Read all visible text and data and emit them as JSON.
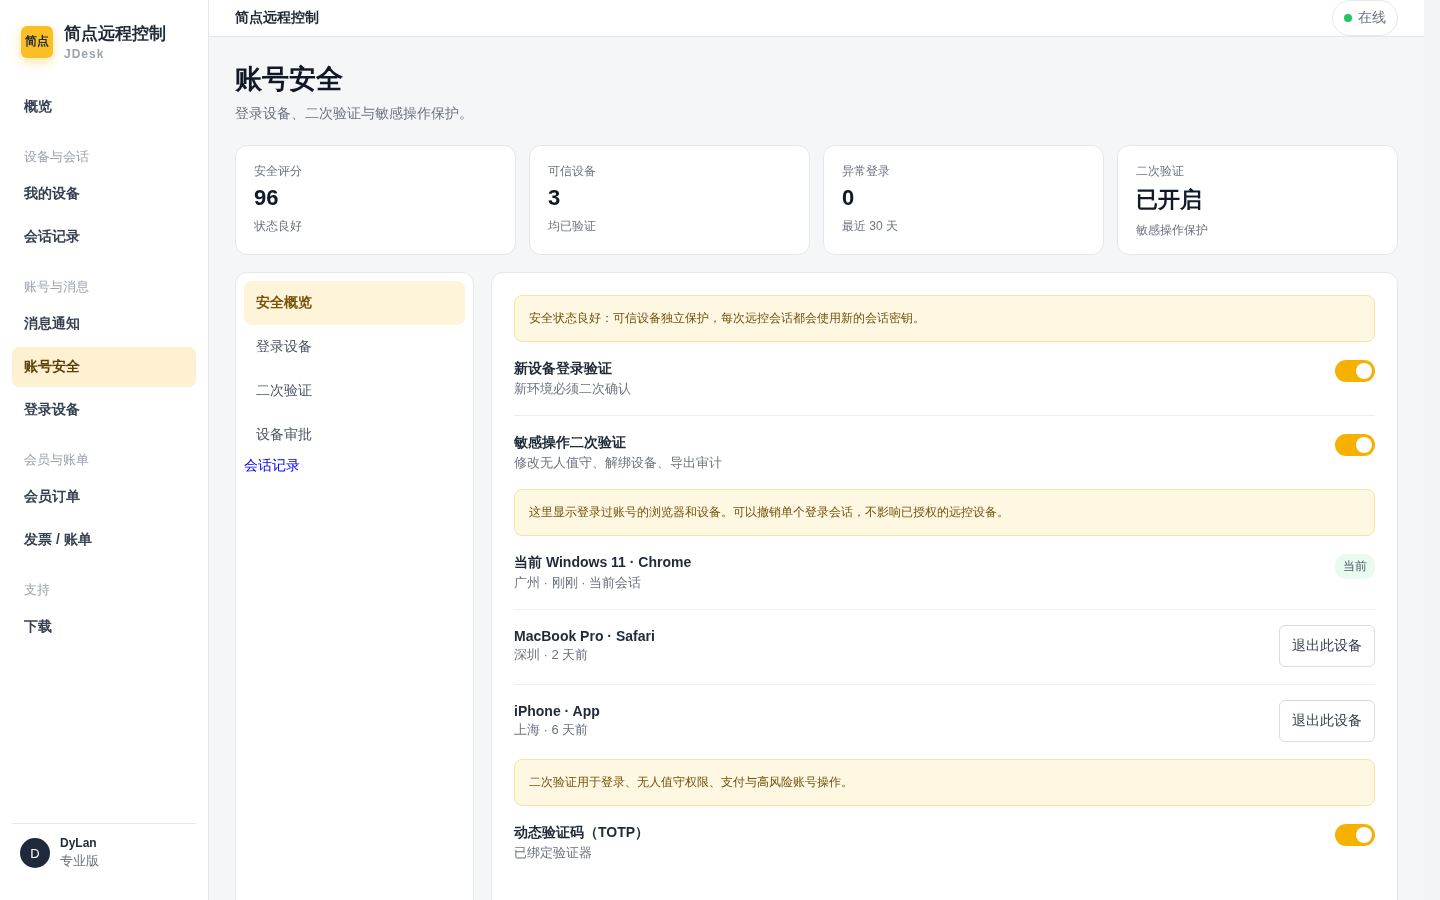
{
  "brand": {
    "logo": "简点",
    "name": "简点远程控制",
    "sub": "JDesk"
  },
  "sidebar": {
    "groups": [
      {
        "items": [
          {
            "label": "概览",
            "selected": false
          }
        ]
      },
      {
        "label": "设备与会话",
        "items": [
          {
            "label": "我的设备",
            "selected": false
          },
          {
            "label": "会话记录",
            "selected": false
          }
        ]
      },
      {
        "label": "账号与消息",
        "items": [
          {
            "label": "消息通知",
            "selected": false
          },
          {
            "label": "账号安全",
            "selected": true
          },
          {
            "label": "登录设备",
            "selected": false
          }
        ]
      },
      {
        "label": "会员与账单",
        "items": [
          {
            "label": "会员订单",
            "selected": false
          },
          {
            "label": "发票 / 账单",
            "selected": false
          }
        ]
      },
      {
        "label": "支持",
        "items": [
          {
            "label": "下载",
            "selected": false
          }
        ]
      }
    ]
  },
  "user": {
    "initial": "D",
    "name": "DyLan",
    "plan": "专业版"
  },
  "topbar": {
    "title": "简点远程控制",
    "status": {
      "label": "在线",
      "color": "#22c55e"
    }
  },
  "page": {
    "title": "账号安全",
    "subtitle": "登录设备、二次验证与敏感操作保护。"
  },
  "stats": [
    {
      "label": "安全评分",
      "value": "96",
      "note": "状态良好"
    },
    {
      "label": "可信设备",
      "value": "3",
      "note": "均已验证"
    },
    {
      "label": "异常登录",
      "value": "0",
      "note": "最近 30 天"
    },
    {
      "label": "二次验证",
      "value": "已开启",
      "note": "敏感操作保护"
    }
  ],
  "subnav": [
    {
      "kind": "tab",
      "label": "安全概览",
      "selected": true
    },
    {
      "kind": "tab",
      "label": "登录设备",
      "selected": false
    },
    {
      "kind": "tab",
      "label": "二次验证",
      "selected": false
    },
    {
      "kind": "tab",
      "label": "设备审批",
      "selected": false
    },
    {
      "kind": "link",
      "label": "会话记录",
      "selected": false
    }
  ],
  "rows": [
    {
      "kind": "notice",
      "text": "安全状态良好：可信设备独立保护，每次远控会话都会使用新的会话密钥。"
    },
    {
      "kind": "toggle",
      "title": "新设备登录验证",
      "sub": "新环境必须二次确认",
      "on": true
    },
    {
      "kind": "toggle",
      "title": "敏感操作二次验证",
      "sub": "修改无人值守、解绑设备、导出审计",
      "on": true
    },
    {
      "kind": "notice",
      "text": "这里显示登录过账号的浏览器和设备。可以撤销单个登录会话，不影响已授权的远控设备。"
    },
    {
      "kind": "device",
      "title": "当前 Windows 11 · Chrome",
      "sub": "广州 · 刚刚 · 当前会话",
      "badge": "当前"
    },
    {
      "kind": "device",
      "title": "MacBook Pro · Safari",
      "sub": "深圳 · 2 天前",
      "button": "退出此设备"
    },
    {
      "kind": "device",
      "title": "iPhone · App",
      "sub": "上海 · 6 天前",
      "button": "退出此设备"
    },
    {
      "kind": "notice",
      "text": "二次验证用于登录、无人值守权限、支付与高风险账号操作。"
    },
    {
      "kind": "toggle",
      "title": "动态验证码（TOTP）",
      "sub": "已绑定验证器",
      "on": true
    }
  ]
}
